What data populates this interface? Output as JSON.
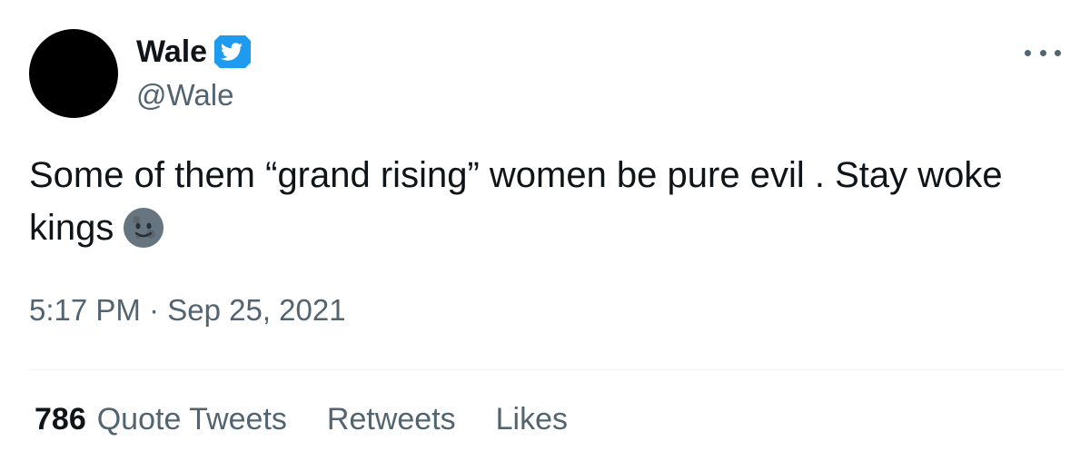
{
  "author": {
    "display_name": "Wale",
    "handle": "@Wale",
    "verified_icon": "verified-badge-icon",
    "avatar_color": "#000000"
  },
  "more_menu_icon": "more-options-icon",
  "tweet": {
    "text": "Some of them “grand rising” women be pure evil . Stay woke kings",
    "emoji": "new-moon-face-emoji",
    "timestamp": "5:17 PM · Sep 25, 2021"
  },
  "stats": {
    "quote_tweets_count": "786",
    "quote_tweets_label": "Quote Tweets",
    "retweets_label": "Retweets",
    "likes_label": "Likes"
  },
  "colors": {
    "text_primary": "#0f1419",
    "text_secondary": "#536471",
    "verified_blue": "#1d9bf0",
    "divider": "#eff3f4"
  }
}
